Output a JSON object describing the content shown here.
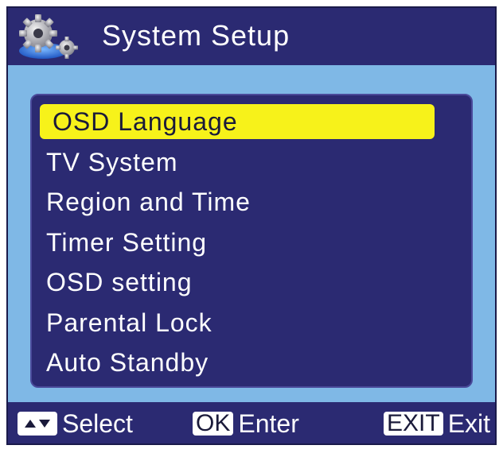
{
  "header": {
    "title": "System Setup",
    "icon": "gear-settings-icon"
  },
  "menu": {
    "items": [
      {
        "label": "OSD Language",
        "selected": true
      },
      {
        "label": "TV System",
        "selected": false
      },
      {
        "label": "Region and Time",
        "selected": false
      },
      {
        "label": "Timer Setting",
        "selected": false
      },
      {
        "label": "OSD setting",
        "selected": false
      },
      {
        "label": "Parental Lock",
        "selected": false
      },
      {
        "label": "Auto Standby",
        "selected": false
      }
    ]
  },
  "footer": {
    "select": {
      "key_icon": "up-down-arrows-icon",
      "label": "Select"
    },
    "enter": {
      "key": "OK",
      "label": "Enter"
    },
    "exit": {
      "key": "EXIT",
      "label": "Exit"
    }
  },
  "colors": {
    "background": "#2b2a72",
    "content_band": "#7fb8e6",
    "highlight": "#f7f21a",
    "text": "#ffffff"
  }
}
